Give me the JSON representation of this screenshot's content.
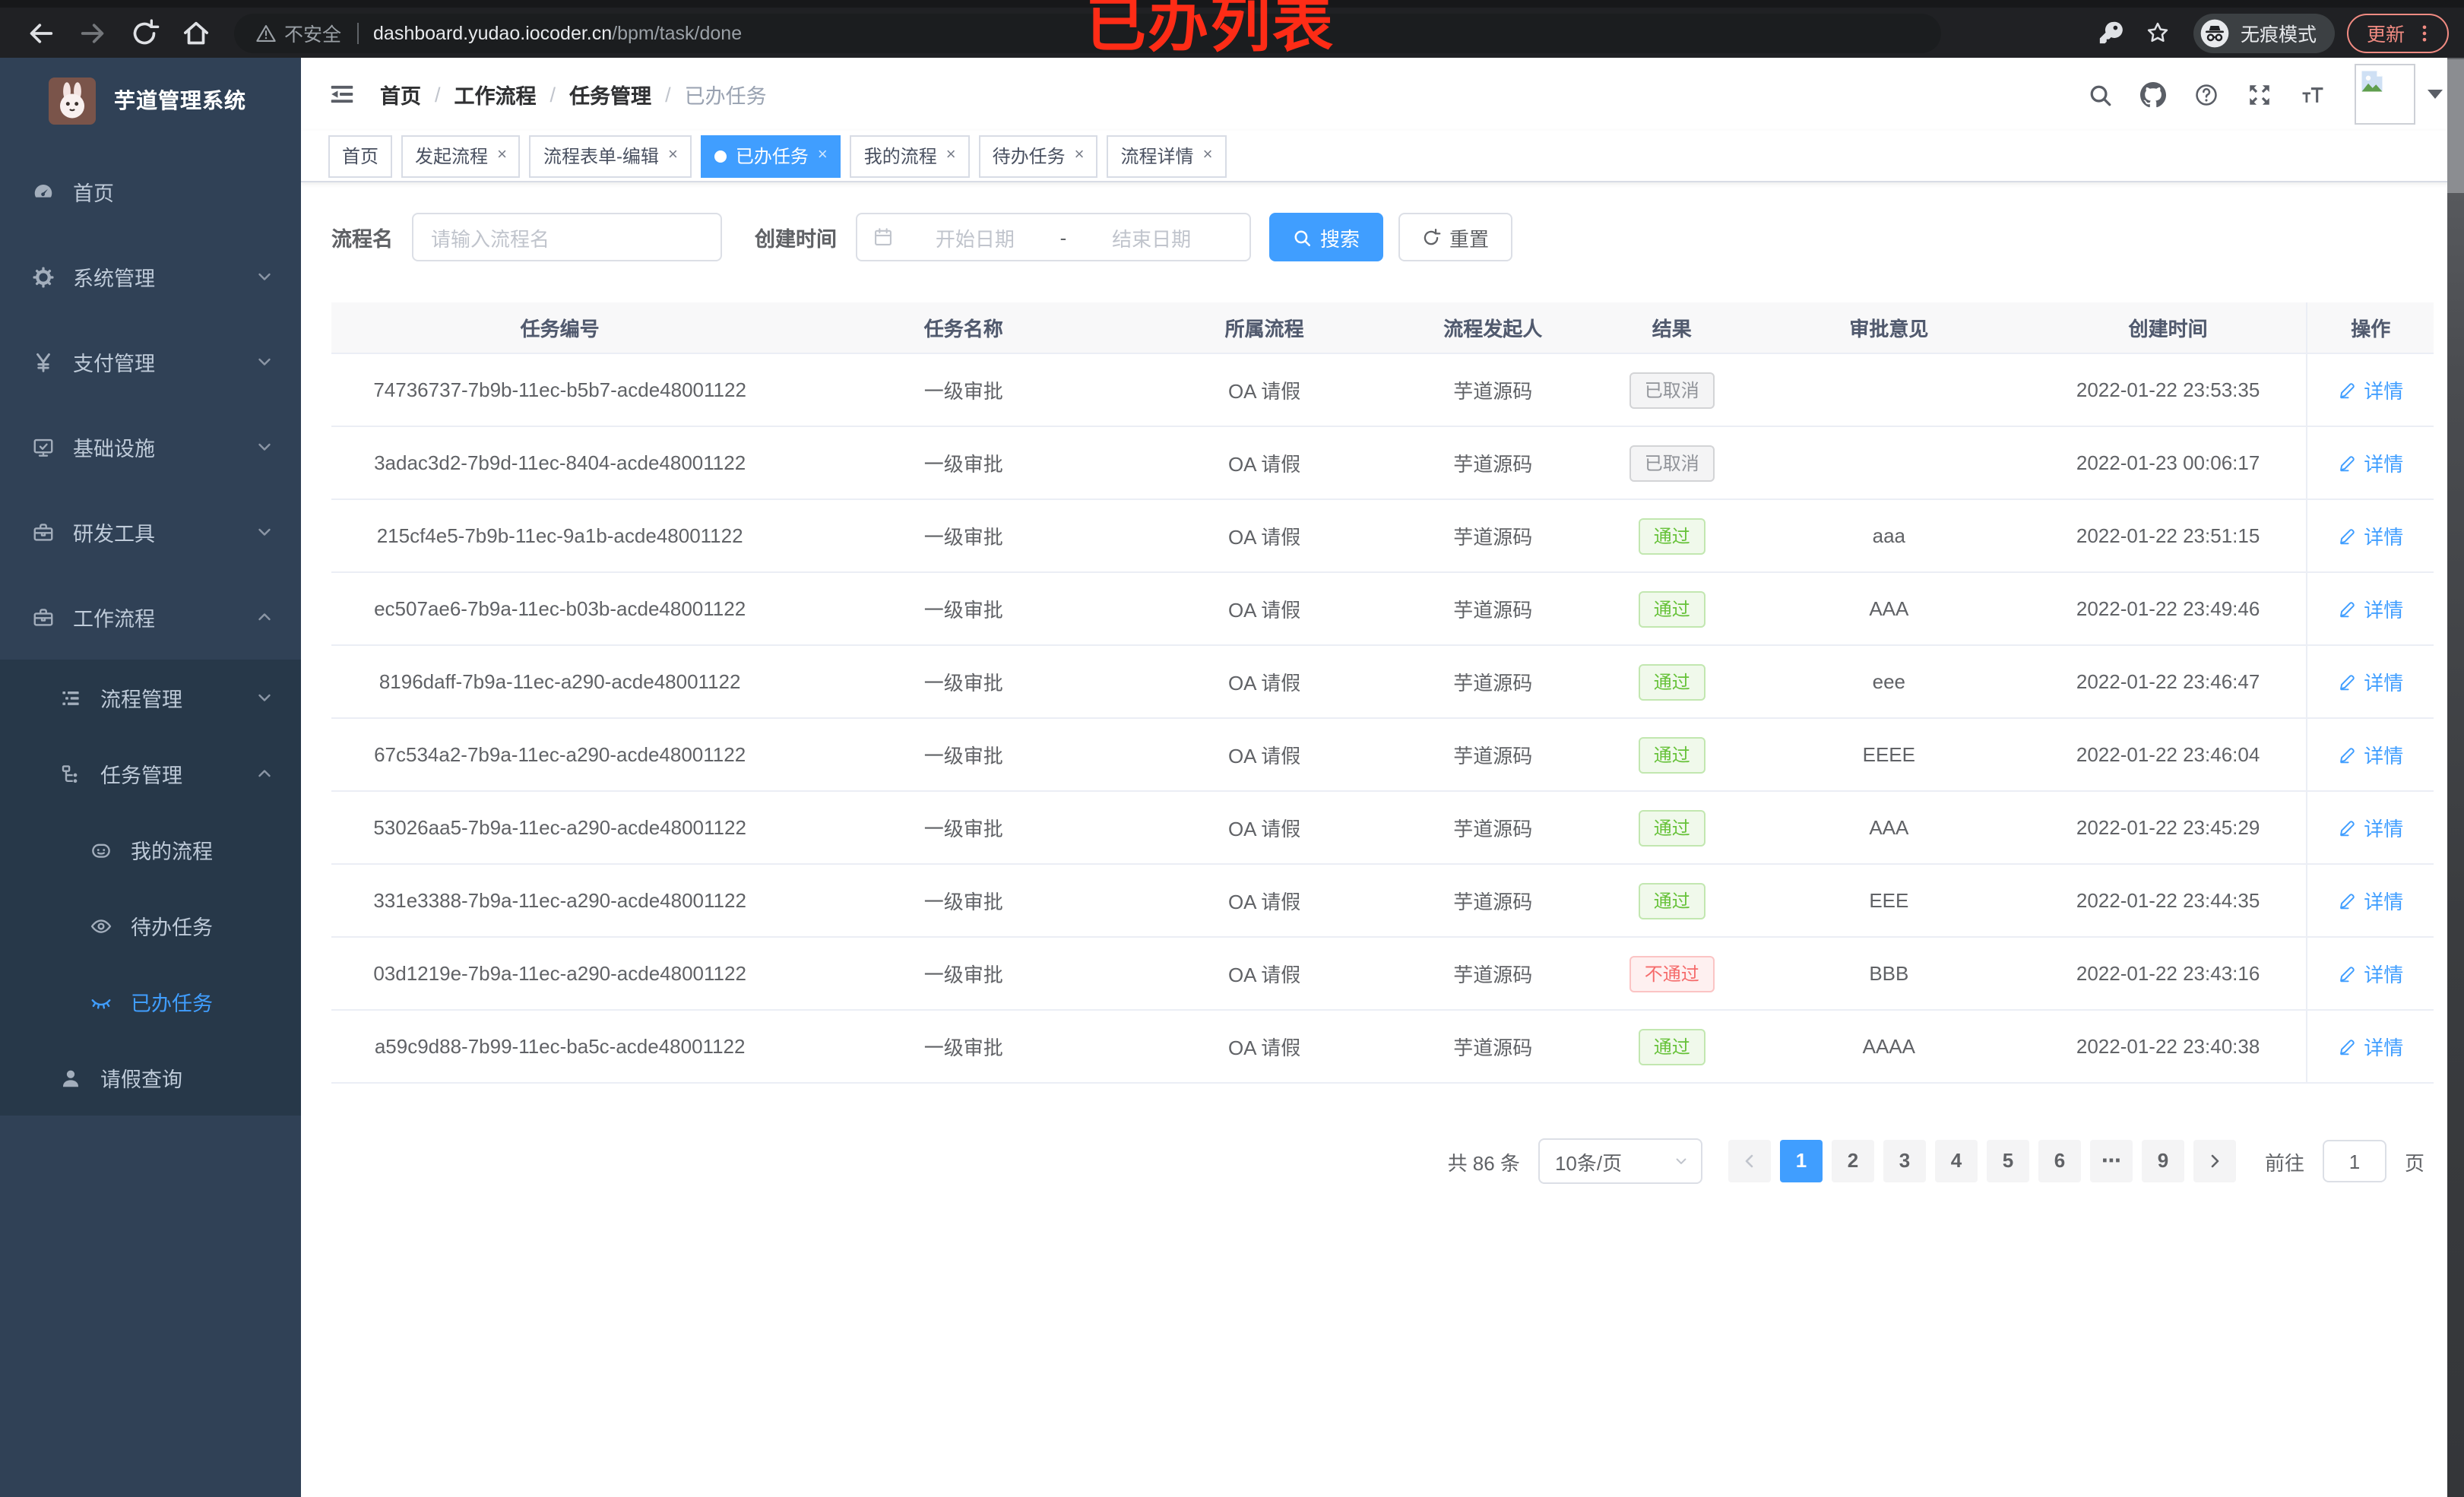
{
  "colors": {
    "accent": "#409EFF",
    "success": "#67C23A",
    "danger": "#F56C6C",
    "info": "#909399",
    "sidebar_bg": "#304156",
    "submenu_bg": "#273849",
    "annotation_red": "#FE2C16"
  },
  "browser": {
    "security_warning": "不安全",
    "url_domain": "dashboard.yudao.iocoder.cn",
    "url_path": "/bpm/task/done",
    "incognito_label": "无痕模式",
    "update_label": "更新",
    "annotation": "已办列表"
  },
  "sidebar": {
    "app_title": "芋道管理系统",
    "menu": [
      {
        "label": "首页",
        "icon": "dashboard-icon",
        "level": 1,
        "chevron": null,
        "submenu": false,
        "active": false
      },
      {
        "label": "系统管理",
        "icon": "gear-icon",
        "level": 1,
        "chevron": "down",
        "submenu": false,
        "active": false
      },
      {
        "label": "支付管理",
        "icon": "yen-icon",
        "level": 1,
        "chevron": "down",
        "submenu": false,
        "active": false
      },
      {
        "label": "基础设施",
        "icon": "monitor-icon",
        "level": 1,
        "chevron": "down",
        "submenu": false,
        "active": false
      },
      {
        "label": "研发工具",
        "icon": "toolbox-icon",
        "level": 1,
        "chevron": "down",
        "submenu": false,
        "active": false
      },
      {
        "label": "工作流程",
        "icon": "briefcase-icon",
        "level": 1,
        "chevron": "up",
        "submenu": false,
        "active": false
      },
      {
        "label": "流程管理",
        "icon": "list-tree-icon",
        "level": 2,
        "chevron": "down",
        "submenu": true,
        "active": false
      },
      {
        "label": "任务管理",
        "icon": "org-tree-icon",
        "level": 2,
        "chevron": "up",
        "submenu": true,
        "active": false
      },
      {
        "label": "我的流程",
        "icon": "robot-icon",
        "level": 3,
        "chevron": null,
        "submenu": true,
        "active": false
      },
      {
        "label": "待办任务",
        "icon": "eye-open-icon",
        "level": 3,
        "chevron": null,
        "submenu": true,
        "active": false
      },
      {
        "label": "已办任务",
        "icon": "eye-closed-icon",
        "level": 3,
        "chevron": null,
        "submenu": true,
        "active": true
      },
      {
        "label": "请假查询",
        "icon": "user-icon",
        "level": 2,
        "chevron": null,
        "submenu": true,
        "active": false
      }
    ]
  },
  "breadcrumb": {
    "separator": "/",
    "items": [
      "首页",
      "工作流程",
      "任务管理",
      "已办任务"
    ]
  },
  "header_icons": [
    "search-icon",
    "github-icon",
    "question-icon",
    "fullscreen-icon",
    "font-size-icon"
  ],
  "tabs": {
    "close_glyph": "×",
    "items": [
      {
        "label": "首页",
        "closable": false,
        "active": false
      },
      {
        "label": "发起流程",
        "closable": true,
        "active": false
      },
      {
        "label": "流程表单-编辑",
        "closable": true,
        "active": false
      },
      {
        "label": "已办任务",
        "closable": true,
        "active": true
      },
      {
        "label": "我的流程",
        "closable": true,
        "active": false
      },
      {
        "label": "待办任务",
        "closable": true,
        "active": false
      },
      {
        "label": "流程详情",
        "closable": true,
        "active": false
      }
    ]
  },
  "filters": {
    "name_label": "流程名",
    "name_placeholder": "请输入流程名",
    "date_label": "创建时间",
    "date_start_placeholder": "开始日期",
    "date_separator": "-",
    "date_end_placeholder": "结束日期",
    "search_label": "搜索",
    "reset_label": "重置"
  },
  "table": {
    "columns": [
      "任务编号",
      "任务名称",
      "所属流程",
      "流程发起人",
      "结果",
      "审批意见",
      "创建时间",
      "操作"
    ],
    "action_label": "详情",
    "rows": [
      {
        "id": "74736737-7b9b-11ec-b5b7-acde48001122",
        "name": "一级审批",
        "flow": "OA 请假",
        "starter": "芋道源码",
        "result": {
          "label": "已取消",
          "type": "info"
        },
        "comment": "",
        "created": "2022-01-22 23:53:35"
      },
      {
        "id": "3adac3d2-7b9d-11ec-8404-acde48001122",
        "name": "一级审批",
        "flow": "OA 请假",
        "starter": "芋道源码",
        "result": {
          "label": "已取消",
          "type": "info"
        },
        "comment": "",
        "created": "2022-01-23 00:06:17"
      },
      {
        "id": "215cf4e5-7b9b-11ec-9a1b-acde48001122",
        "name": "一级审批",
        "flow": "OA 请假",
        "starter": "芋道源码",
        "result": {
          "label": "通过",
          "type": "success"
        },
        "comment": "aaa",
        "created": "2022-01-22 23:51:15"
      },
      {
        "id": "ec507ae6-7b9a-11ec-b03b-acde48001122",
        "name": "一级审批",
        "flow": "OA 请假",
        "starter": "芋道源码",
        "result": {
          "label": "通过",
          "type": "success"
        },
        "comment": "AAA",
        "created": "2022-01-22 23:49:46"
      },
      {
        "id": "8196daff-7b9a-11ec-a290-acde48001122",
        "name": "一级审批",
        "flow": "OA 请假",
        "starter": "芋道源码",
        "result": {
          "label": "通过",
          "type": "success"
        },
        "comment": "eee",
        "created": "2022-01-22 23:46:47"
      },
      {
        "id": "67c534a2-7b9a-11ec-a290-acde48001122",
        "name": "一级审批",
        "flow": "OA 请假",
        "starter": "芋道源码",
        "result": {
          "label": "通过",
          "type": "success"
        },
        "comment": "EEEE",
        "created": "2022-01-22 23:46:04"
      },
      {
        "id": "53026aa5-7b9a-11ec-a290-acde48001122",
        "name": "一级审批",
        "flow": "OA 请假",
        "starter": "芋道源码",
        "result": {
          "label": "通过",
          "type": "success"
        },
        "comment": "AAA",
        "created": "2022-01-22 23:45:29"
      },
      {
        "id": "331e3388-7b9a-11ec-a290-acde48001122",
        "name": "一级审批",
        "flow": "OA 请假",
        "starter": "芋道源码",
        "result": {
          "label": "通过",
          "type": "success"
        },
        "comment": "EEE",
        "created": "2022-01-22 23:44:35"
      },
      {
        "id": "03d1219e-7b9a-11ec-a290-acde48001122",
        "name": "一级审批",
        "flow": "OA 请假",
        "starter": "芋道源码",
        "result": {
          "label": "不通过",
          "type": "danger"
        },
        "comment": "BBB",
        "created": "2022-01-22 23:43:16"
      },
      {
        "id": "a59c9d88-7b99-11ec-ba5c-acde48001122",
        "name": "一级审批",
        "flow": "OA 请假",
        "starter": "芋道源码",
        "result": {
          "label": "通过",
          "type": "success"
        },
        "comment": "AAAA",
        "created": "2022-01-22 23:40:38"
      }
    ]
  },
  "pagination": {
    "total_label": "共 86 条",
    "page_size": "10条/页",
    "pages": [
      "1",
      "2",
      "3",
      "4",
      "5",
      "6",
      "⋯",
      "9"
    ],
    "active_page": "1",
    "jump_prefix": "前往",
    "jump_value": "1",
    "jump_suffix": "页"
  }
}
